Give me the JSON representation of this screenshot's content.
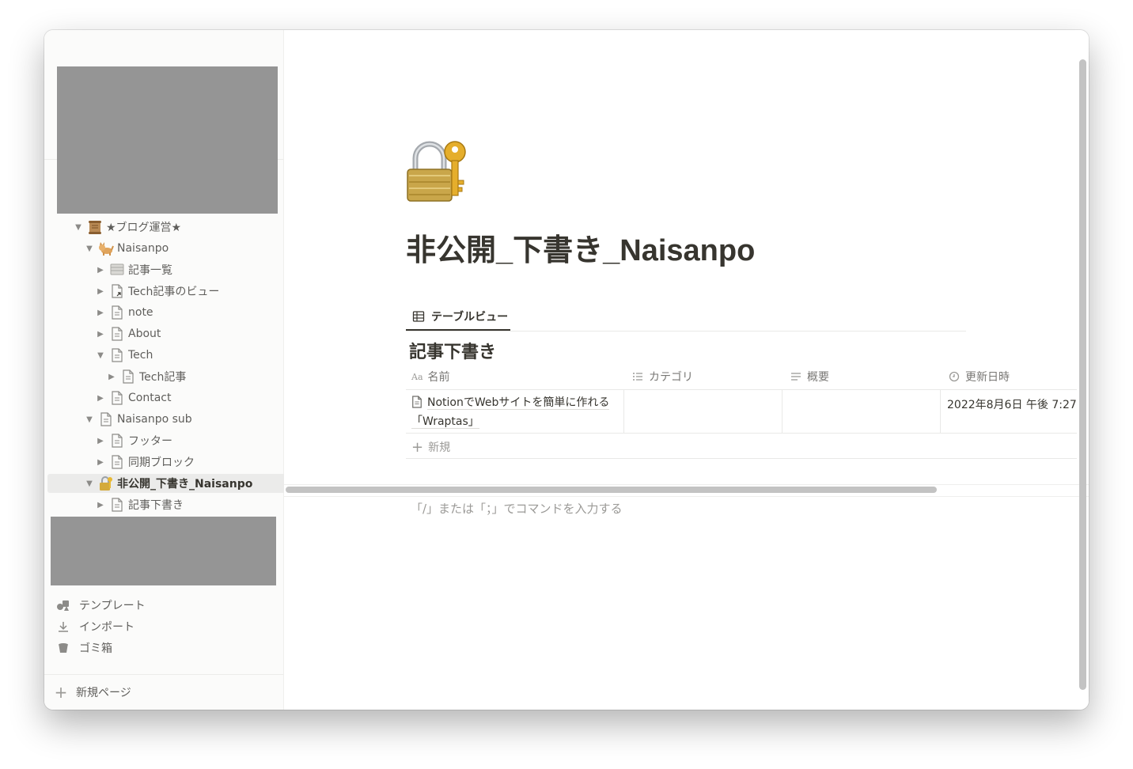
{
  "sidebar": {
    "tree": [
      {
        "label": "★ブログ運営★",
        "icon": "scroll-emoji-icon",
        "expanded": true
      },
      {
        "label": "Naisanpo",
        "icon": "cat-emoji-icon",
        "expanded": true
      },
      {
        "label": "記事一覧",
        "icon": "database-icon",
        "expanded": false
      },
      {
        "label": "Tech記事のビュー",
        "icon": "linked-page-icon",
        "expanded": false
      },
      {
        "label": "note",
        "icon": "page-icon",
        "expanded": false
      },
      {
        "label": "About",
        "icon": "page-icon",
        "expanded": false
      },
      {
        "label": "Tech",
        "icon": "page-icon",
        "expanded": true
      },
      {
        "label": "Tech記事",
        "icon": "page-icon",
        "expanded": false
      },
      {
        "label": "Contact",
        "icon": "page-icon",
        "expanded": false
      },
      {
        "label": "Naisanpo sub",
        "icon": "page-icon",
        "expanded": true
      },
      {
        "label": "フッター",
        "icon": "page-icon",
        "expanded": false
      },
      {
        "label": "同期ブロック",
        "icon": "page-icon",
        "expanded": false
      },
      {
        "label": "非公開_下書き_Naisanpo",
        "icon": "lock-key-emoji-icon",
        "expanded": true,
        "selected": true
      },
      {
        "label": "記事下書き",
        "icon": "page-icon",
        "expanded": false
      }
    ],
    "tools": [
      {
        "label": "テンプレート",
        "icon": "shapes-icon"
      },
      {
        "label": "インポート",
        "icon": "download-icon"
      },
      {
        "label": "ゴミ箱",
        "icon": "trash-icon"
      }
    ],
    "new_page_label": "新規ページ"
  },
  "main": {
    "page_icon": "lock-with-key-emoji-icon",
    "title": "非公開_下書き_Naisanpo",
    "view_tab_label": "テーブルビュー",
    "database_title": "記事下書き",
    "columns": [
      {
        "label": "名前",
        "icon": "title-aa-icon",
        "icon_text": "Aa"
      },
      {
        "label": "カテゴリ",
        "icon": "multi-select-icon"
      },
      {
        "label": "概要",
        "icon": "text-lines-icon"
      },
      {
        "label": "更新日時",
        "icon": "clock-icon"
      }
    ],
    "rows": [
      {
        "name": "NotionでWebサイトを簡単に作れる「Wraptas」",
        "category": "",
        "summary": "",
        "updated": "2022年8月6日 午後 7:27"
      }
    ],
    "new_row_label": "新規",
    "command_placeholder": "「/」または「；」でコマンドを入力する"
  }
}
